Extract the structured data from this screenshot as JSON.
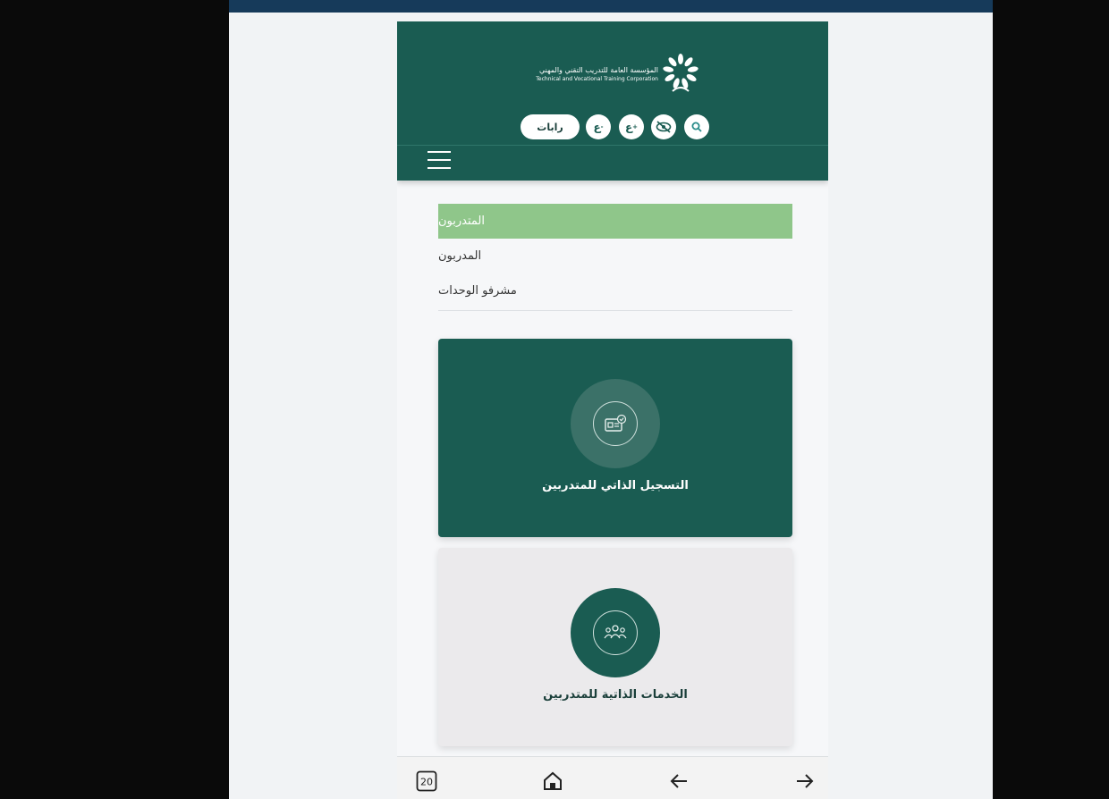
{
  "colors": {
    "primary": "#1a5c52",
    "active_nav": "#8fc68a",
    "background": "#f6f7f9"
  },
  "header": {
    "logo_ar": "المؤسسة العامة للتدريب التقني والمهني",
    "logo_en": "Technical and Vocational Training Corporation",
    "links_label": "رابات",
    "toolbar_icons": [
      "font-decrease-icon",
      "font-increase-icon",
      "eye-slash-icon",
      "search-icon"
    ],
    "font_decrease_glyph": "ع",
    "font_increase_glyph": "ع"
  },
  "nav": {
    "items": [
      {
        "label": "المتدربون",
        "active": true
      },
      {
        "label": "المدربون",
        "active": false
      },
      {
        "label": "مشرفو الوحدات",
        "active": false
      }
    ]
  },
  "cards": [
    {
      "label": "التسجيل الذاتي للمتدربين",
      "icon": "id-card-check-icon"
    },
    {
      "label": "الخدمات الذاتية للمتدربين",
      "icon": "people-group-icon"
    }
  ],
  "bottom_bar": {
    "tabs_count": "20",
    "icons": [
      "tabs-icon",
      "home-icon",
      "back-arrow-icon",
      "forward-arrow-icon"
    ]
  }
}
